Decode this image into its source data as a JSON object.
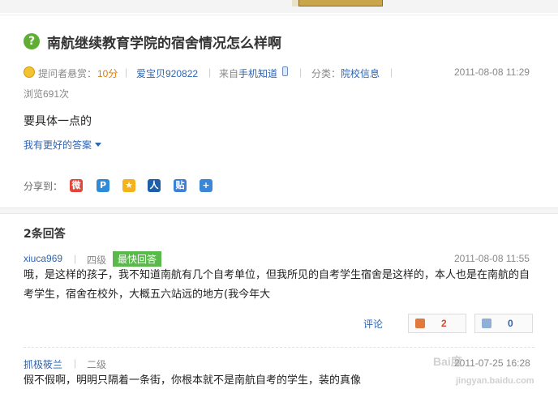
{
  "question": {
    "title": "南航继续教育学院的宿舍情况怎么样啊",
    "bounty_label": "提问者悬赏：",
    "bounty_value": "10分",
    "asker": "爱宝贝920822",
    "source_prefix": "来自",
    "source": "手机知道",
    "category_prefix": "分类：",
    "category": "院校信息",
    "time": "2011-08-08 11:29",
    "views": "浏览691次",
    "body": "要具体一点的",
    "better_answer": "我有更好的答案"
  },
  "share": {
    "label": "分享到：",
    "targets": [
      {
        "name": "weibo",
        "glyph": "微",
        "color": "#e2463a"
      },
      {
        "name": "qzone",
        "glyph": "P",
        "color": "#2f8ad8"
      },
      {
        "name": "star",
        "glyph": "★",
        "color": "#f3b21e"
      },
      {
        "name": "renren",
        "glyph": "人",
        "color": "#1d5fa8"
      },
      {
        "name": "tieba",
        "glyph": "贴",
        "color": "#3d7fd9"
      },
      {
        "name": "more",
        "glyph": "+",
        "color": "#3b86d6"
      }
    ]
  },
  "answers": {
    "count_label": "2条回答",
    "items": [
      {
        "user": "xiuca969",
        "level": "四级",
        "badge": "最快回答",
        "time": "2011-08-08 11:55",
        "text": "哦，是这样的孩子，我不知道南航有几个自考单位，但我所见的自考学生宿舍是这样的，本人也是在南航的自考学生，宿舍在校外，大概五六站远的地方(我今年大",
        "comment_label": "评论",
        "up": "2",
        "down": "0"
      },
      {
        "user": "抓极筱兰",
        "level": "二级",
        "time": "2011-07-25 16:28",
        "text": "假不假啊，明明只隔着一条街，你根本就不是南航自考的学生，装的真像"
      }
    ]
  },
  "colors": {
    "link": "#2d64b3",
    "orange": "#e67a00",
    "badge": "#59b94a",
    "qicon": "#5fae33"
  }
}
